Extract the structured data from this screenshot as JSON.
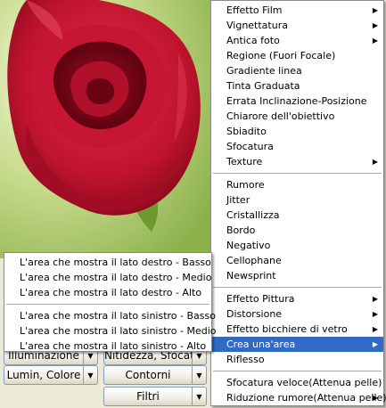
{
  "photo": {
    "subject": "red rose photograph"
  },
  "toolbar": {
    "row1_left": "Illuminazione",
    "row1_right": "Nitidezza, Sfocatura",
    "row2_left": "Lumin, Colore",
    "row2_right": "Contorni",
    "row3": "Filtri"
  },
  "submenu": {
    "items": [
      "L'area che mostra il lato destro - Basso",
      "L'area che mostra il lato destro - Medio",
      "L'area che mostra il lato destro - Alto",
      "L'area che mostra il lato sinistro - Basso",
      "L'area che mostra il lato sinistro - Medio",
      "L'area che mostra il lato sinistro - Alto"
    ]
  },
  "menu": {
    "items": [
      "Effetto Film",
      "Vignettatura",
      "Antica foto",
      "Regione (Fuori Focale)",
      "Gradiente linea",
      "Tinta Graduata",
      "Errata Inclinazione-Posizione",
      "Chiarore dell'obiettivo",
      "Sbiadito",
      "Sfocatura",
      "Texture",
      "Rumore",
      "Jitter",
      "Cristallizza",
      "Bordo",
      "Negativo",
      "Cellophane",
      "Newsprint",
      "Effetto Pittura",
      "Distorsione",
      "Effetto bicchiere di vetro",
      "Crea una'area",
      "Riflesso",
      "Sfocatura veloce(Attenua pelle)",
      "Riduzione rumore(Attenua pelle)"
    ],
    "highlight_color": "#316ac5"
  }
}
